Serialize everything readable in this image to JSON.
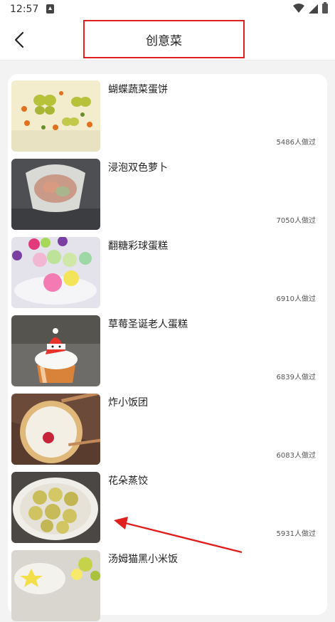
{
  "status_bar": {
    "time": "12:57"
  },
  "header": {
    "title": "创意菜"
  },
  "recipes": [
    {
      "name": "蝴蝶蔬菜蛋饼",
      "count": "5486人做过"
    },
    {
      "name": "浸泡双色萝卜",
      "count": "7050人做过"
    },
    {
      "name": "翻糖彩球蛋糕",
      "count": "6910人做过"
    },
    {
      "name": "草莓圣诞老人蛋糕",
      "count": "6839人做过"
    },
    {
      "name": "炸小饭团",
      "count": "6083人做过"
    },
    {
      "name": "花朵蒸饺",
      "count": "5931人做过"
    },
    {
      "name": "汤姆猫黑小米饭",
      "count": ""
    }
  ],
  "colors": {
    "annotation": "#e0201e",
    "accent_border": "#e0201e"
  }
}
